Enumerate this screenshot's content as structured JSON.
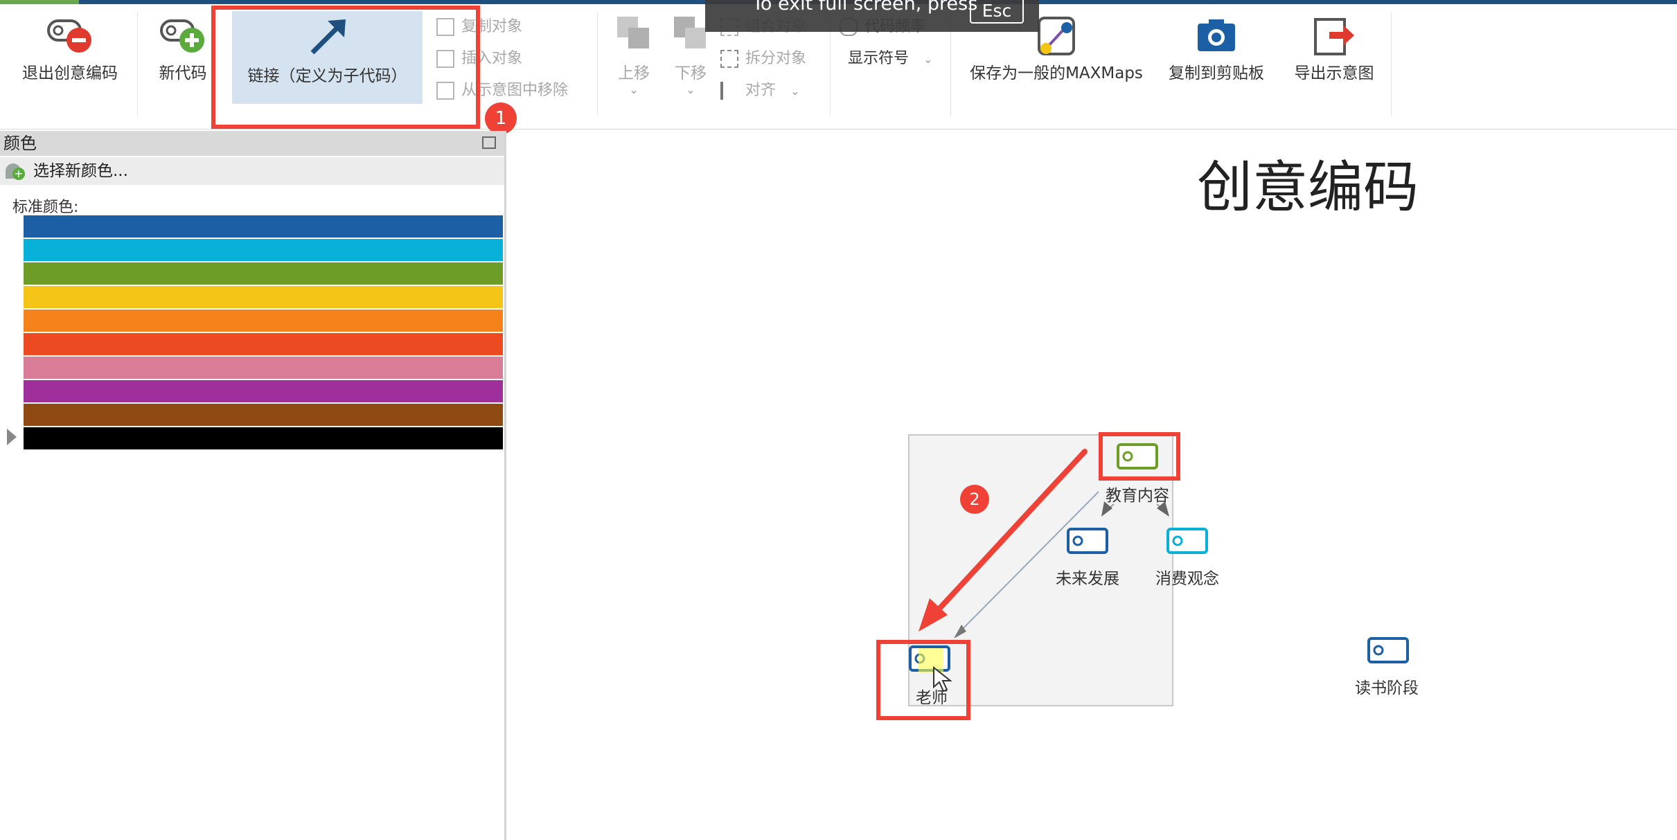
{
  "fullscreen_banner": {
    "text": "To exit full screen, press",
    "key": "Esc"
  },
  "ribbon": {
    "exit_label": "退出创意编码",
    "new_code_label": "新代码",
    "link_label": "链接（定义为子代码）",
    "copy_object": "复制对象",
    "insert_object": "插入对象",
    "remove_from_map": "从示意图中移除",
    "move_up": "上移",
    "move_down": "下移",
    "group_object": "组合对象",
    "ungroup_object": "拆分对象",
    "align": "对齐",
    "code_frequency": "代码频率",
    "show_symbols": "显示符号",
    "save_as_maxmaps": "保存为一般的MAXMaps",
    "copy_clipboard": "复制到剪贴板",
    "export_map": "导出示意图"
  },
  "annotations": {
    "badge1": "1",
    "badge2": "2"
  },
  "color_panel": {
    "title": "颜色",
    "pick_new": "选择新颜色...",
    "standard_label": "标准颜色:",
    "swatches": [
      "#1c5fa4",
      "#06b0d6",
      "#6d9d27",
      "#f4c416",
      "#f6821c",
      "#ec4a20",
      "#d97c98",
      "#9f2f9b",
      "#8e4a12",
      "#000000"
    ]
  },
  "canvas": {
    "title": "创意编码",
    "nodes": {
      "education": {
        "label": "教育内容",
        "color": "#6d9d27"
      },
      "future": {
        "label": "未来发展",
        "color": "#1c5fa4"
      },
      "consumption": {
        "label": "消费观念",
        "color": "#06b0d6"
      },
      "teacher": {
        "label": "老师",
        "color": "#1c5fa4"
      },
      "reading": {
        "label": "读书阶段",
        "color": "#1c5fa4"
      }
    }
  }
}
